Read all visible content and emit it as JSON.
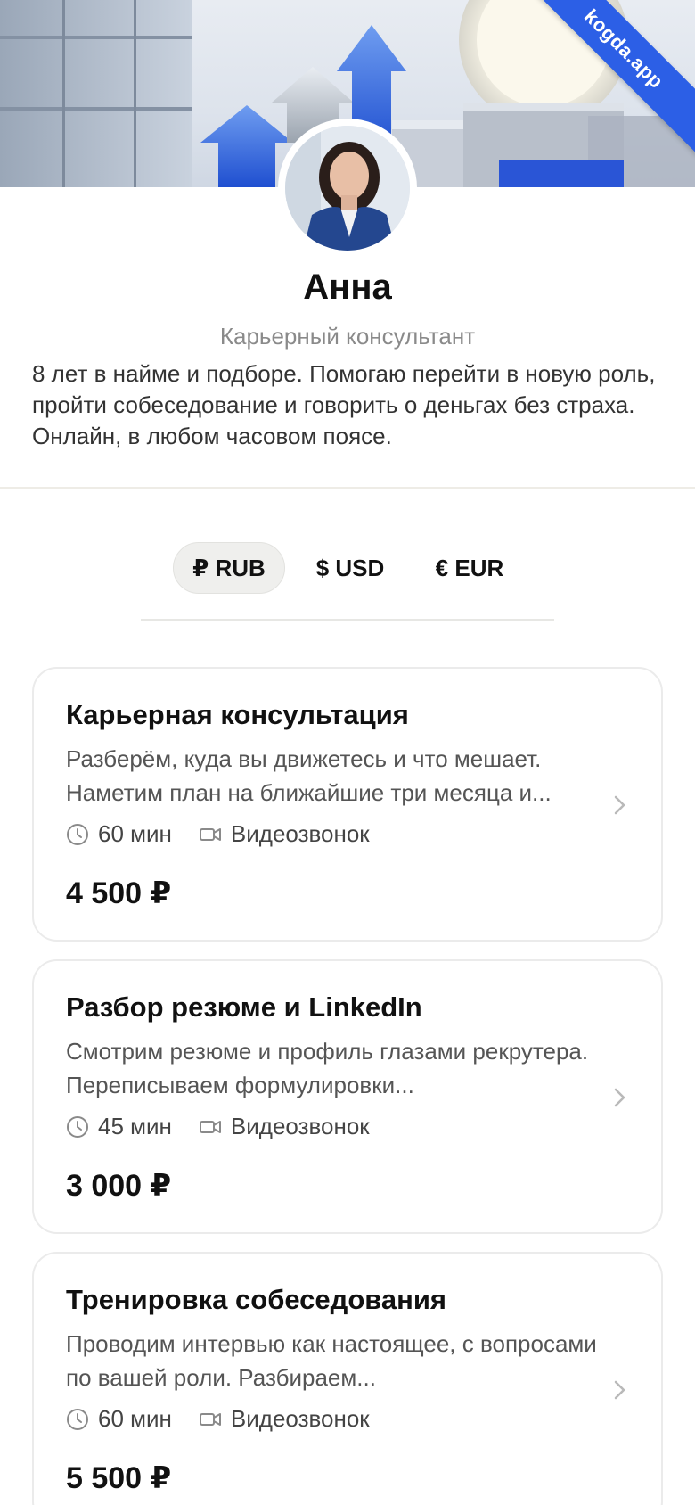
{
  "banner": {
    "badge": "kogda.app"
  },
  "profile": {
    "name": "Анна",
    "role": "Карьерный консультант",
    "bio": "8 лет в найме и подборе. Помогаю перейти в новую роль, пройти собеседование и говорить о деньгах без страха. Онлайн, в любом часовом поясе."
  },
  "currency": {
    "selected": "RUB",
    "tabs": [
      {
        "label": "₽ RUB"
      },
      {
        "label": "$ USD"
      },
      {
        "label": "€ EUR"
      }
    ]
  },
  "services": [
    {
      "title": "Карьерная консультация",
      "description": "Разберём, куда вы движетесь и что мешает. Наметим план на ближайшие три месяца и...",
      "duration": "60 мин",
      "format": "Видеозвонок",
      "price": "4 500 ₽"
    },
    {
      "title": "Разбор резюме и LinkedIn",
      "description": "Смотрим резюме и профиль глазами рекрутера. Переписываем формулировки...",
      "duration": "45 мин",
      "format": "Видеозвонок",
      "price": "3 000 ₽"
    },
    {
      "title": "Тренировка собеседования",
      "description": "Проводим интервью как настоящее, с вопросами по вашей роли. Разбираем...",
      "duration": "60 мин",
      "format": "Видеозвонок",
      "price": "5 500 ₽"
    }
  ],
  "icons": {
    "duration": "clock-icon",
    "format": "video-camera-icon",
    "open": "chevron-right-icon"
  },
  "colors": {
    "accent": "#2c5fe6",
    "muted": "#8a8a8a",
    "active_tab_bg": "#efefed"
  }
}
